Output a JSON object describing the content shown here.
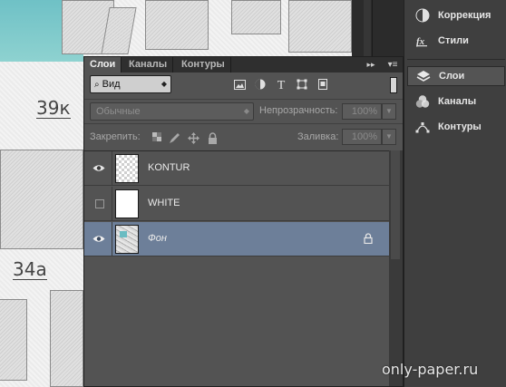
{
  "canvas": {
    "piece_labels": [
      "39к",
      "34а"
    ]
  },
  "dock": {
    "items": [
      {
        "label": "Коррекция",
        "icon": "adjustments-icon"
      },
      {
        "label": "Стили",
        "icon": "styles-icon"
      },
      {
        "label": "Слои",
        "icon": "layers-icon",
        "active": true
      },
      {
        "label": "Каналы",
        "icon": "channels-icon"
      },
      {
        "label": "Контуры",
        "icon": "paths-icon"
      }
    ]
  },
  "panel": {
    "tabs": [
      "Слои",
      "Каналы",
      "Контуры"
    ],
    "collapse_label": "▸▸",
    "menu_label": "▾≡",
    "filter": {
      "kind_value": "Вид",
      "filter_icons": [
        "image-filter-icon",
        "adjustment-filter-icon",
        "type-filter-icon",
        "shape-filter-icon",
        "smart-object-filter-icon"
      ]
    },
    "blend": {
      "mode_value": "Обычные",
      "opacity_label": "Непрозрачность:",
      "opacity_value": "100%"
    },
    "lock": {
      "label": "Закрепить:",
      "fill_label": "Заливка:",
      "fill_value": "100%"
    },
    "layers": [
      {
        "name": "KONTUR",
        "visible": true,
        "thumb": "transparent",
        "selected": false,
        "locked": false
      },
      {
        "name": "WHITE",
        "visible": false,
        "thumb": "white",
        "selected": false,
        "locked": false
      },
      {
        "name": "Фон",
        "visible": true,
        "thumb": "image",
        "selected": true,
        "locked": true
      }
    ]
  },
  "watermark": "only-paper.ru",
  "colors": {
    "panel_bg": "#535353",
    "selected_layer": "#6d7f99",
    "dock_bg": "#3f3f3f",
    "accent_teal": "#6fc1c6"
  }
}
